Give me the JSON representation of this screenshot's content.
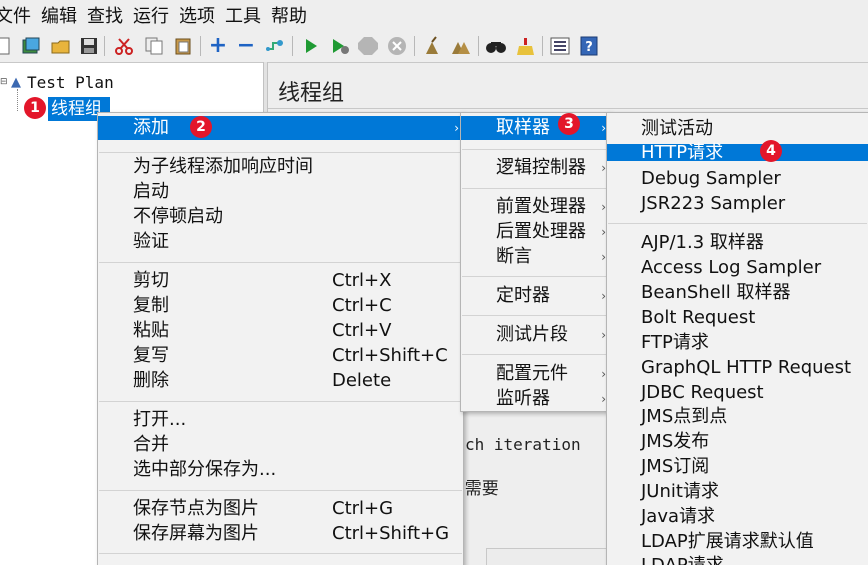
{
  "menubar": {
    "items": [
      "文件",
      "编辑",
      "查找",
      "运行",
      "选项",
      "工具",
      "帮助"
    ]
  },
  "toolbar": {
    "icons": [
      "new-icon",
      "templates-icon",
      "open-icon",
      "save-icon",
      "cut-icon",
      "copy-icon",
      "paste-icon",
      "expand-icon",
      "collapse-icon",
      "toggle-icon",
      "start-icon",
      "start-no-pause-icon",
      "stop-icon",
      "shutdown-icon",
      "clear-icon",
      "clear-all-icon",
      "search-icon",
      "reset-search-icon",
      "function-helper-icon",
      "help-icon"
    ]
  },
  "tree": {
    "root_label": "Test Plan",
    "selected_label": "线程组"
  },
  "pane": {
    "title": "线程组",
    "partial_text_1": "ch iteration",
    "partial_text_2": "l需要"
  },
  "context_menu": {
    "add_label": "添加",
    "items": [
      {
        "label": "为子线程添加响应时间",
        "accel": ""
      },
      {
        "label": "启动",
        "accel": ""
      },
      {
        "label": "不停顿启动",
        "accel": ""
      },
      {
        "label": "验证",
        "accel": ""
      },
      {
        "label": "剪切",
        "accel": "Ctrl+X"
      },
      {
        "label": "复制",
        "accel": "Ctrl+C"
      },
      {
        "label": "粘贴",
        "accel": "Ctrl+V"
      },
      {
        "label": "复写",
        "accel": "Ctrl+Shift+C"
      },
      {
        "label": "删除",
        "accel": "Delete"
      },
      {
        "label": "打开...",
        "accel": ""
      },
      {
        "label": "合并",
        "accel": ""
      },
      {
        "label": "选中部分保存为...",
        "accel": ""
      },
      {
        "label": "保存节点为图片",
        "accel": "Ctrl+G"
      },
      {
        "label": "保存屏幕为图片",
        "accel": "Ctrl+Shift+G"
      }
    ]
  },
  "add_submenu": {
    "items": [
      "取样器",
      "逻辑控制器",
      "前置处理器",
      "后置处理器",
      "断言",
      "定时器",
      "测试片段",
      "配置元件",
      "监听器"
    ]
  },
  "sampler_submenu": {
    "items": [
      "测试活动",
      "HTTP请求",
      "Debug Sampler",
      "JSR223 Sampler",
      "AJP/1.3 取样器",
      "Access Log Sampler",
      "BeanShell 取样器",
      "Bolt Request",
      "FTP请求",
      "GraphQL HTTP Request",
      "JDBC Request",
      "JMS点到点",
      "JMS发布",
      "JMS订阅",
      "JUnit请求",
      "Java请求",
      "LDAP扩展请求默认值",
      "LDAP请求"
    ]
  },
  "badges": [
    "1",
    "2",
    "3",
    "4"
  ],
  "colors": {
    "highlight": "#0078d7",
    "badge": "#e3162a"
  }
}
